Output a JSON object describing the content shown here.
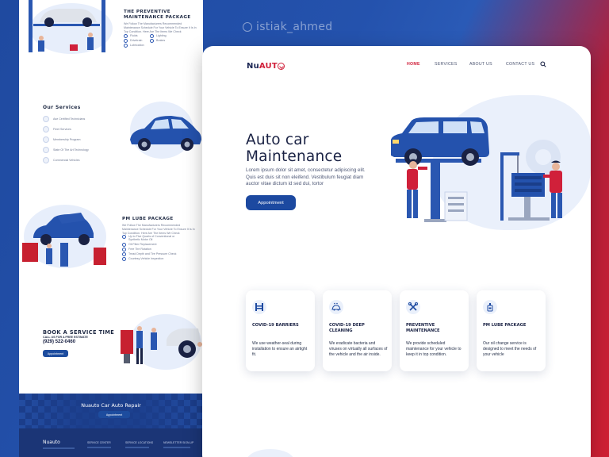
{
  "watermark": "istiak_ahmed",
  "left_page": {
    "maintenance": {
      "title": "THE PREVENTIVE MAINTENANCE PACKAGE",
      "text": "We Follow The Manufacturers Recommended Maintenance Schedule For Your Vehicle To Ensure It Is In Top Condition. Here Are The Items We Check",
      "bullets": [
        "Fluids",
        "Drivetrain",
        "Lubrication",
        "Lighting",
        "Brakes",
        "Wipers"
      ]
    },
    "services": {
      "title": "Our Services",
      "items": [
        "Ase Certified Technicians",
        "Fleet Services",
        "Membership Program",
        "State Of The Art Technology",
        "Commercial Vehicles"
      ]
    },
    "lube": {
      "title": "PM LUBE PACKAGE",
      "text": "We Follow The Manufacturers Recommended Maintenance Schedule For Your Vehicle To Ensure It Is In Top Condition. Here Are The Items We Check",
      "bullets": [
        "Up to Five Quarts of Conventional or Synthetic Motor Oil",
        "Oil Filter Replacement",
        "Free Tire Rotation",
        "Tread Depth and Tire Pressure Check",
        "Courtesy Vehicle Inspection"
      ]
    },
    "book": {
      "title": "BOOK A SERVICE TIME",
      "subtitle": "CALL US FOR A FREE ESTIMATE",
      "phone": "(929) 522-0460",
      "button": "Appointment"
    },
    "banner": {
      "title": "Nuauto Car Auto Repair",
      "button": "Appointment"
    },
    "footer": {
      "brand": "Nuauto",
      "cols": [
        "SERVICE CENTER",
        "SERVICE LOCATIONS",
        "NEWSLETTER SIGN-UP"
      ]
    }
  },
  "main": {
    "logo": {
      "nu": "Nu",
      "auto": "AUT"
    },
    "nav": [
      "HOME",
      "SERVICES",
      "ABOUT US",
      "CONTACT US"
    ],
    "hero": {
      "title_line1": "Auto car",
      "title_line2": "Maintenance",
      "description": "Lorem ipsum dolor sit amet, consectetur adipiscing elit. Quis est duis sit non eleifend. Vestibulum feugiat diam auctor vitae dictum id sed dui, tortor",
      "button": "Appointment"
    },
    "cards": [
      {
        "icon": "lift-icon",
        "title": "COVID-19 BARRIERS",
        "text": "We use weather-seal during installation to ensure an airtight fit."
      },
      {
        "icon": "car-wash-icon",
        "title": "COVID-19 DEEP CLEANING",
        "text": "We eradicate bacteria and viruses on virtually all surfaces of the vehicle and the air inside."
      },
      {
        "icon": "wrench-icon",
        "title": "PREVENTIVE MAINTENANCE",
        "text": "We provide scheduled maintenance for your vehicle to keep it in top condition."
      },
      {
        "icon": "oil-bottle-icon",
        "title": "PM LUBE PACKAGE",
        "text": "Our oil change service is designed to meet the needs of your vehicle"
      }
    ]
  },
  "colors": {
    "brand_blue": "#1c49a0",
    "brand_red": "#d0203a",
    "dark_text": "#1a2244"
  }
}
